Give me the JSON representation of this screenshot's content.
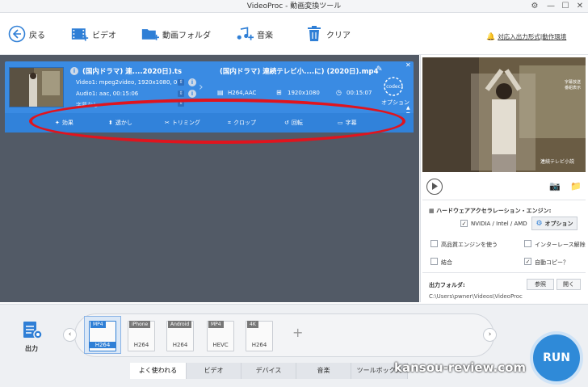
{
  "window": {
    "title": "VideoProc - 動画変換ツール",
    "controls": [
      "gear-icon",
      "minimize-icon",
      "maximize-icon",
      "close-icon"
    ]
  },
  "toolbar": {
    "back": "戻る",
    "video": "ビデオ",
    "video_folder": "動画フォルダ",
    "music": "音楽",
    "clear": "クリア",
    "notice": "対応入出力形式|動作環境"
  },
  "file": {
    "input_name": "(国内ドラマ) 連....2020日).ts",
    "video_info": "Video1: mpeg2video, 1920x1080, 0...",
    "audio_info": "Audio1: aac, 00:15:06",
    "subtitle_info": "字幕なし",
    "output_name": "(国内ドラマ) 連続テレビ小....に) (2020日).mp4",
    "output_codec": "H264,AAC",
    "output_resolution": "1920x1080",
    "output_duration": "00:15:07",
    "option_label": "オプション",
    "codec_label": "codec"
  },
  "edit": {
    "effect": "効果",
    "watermark": "透かし",
    "trim": "トリミング",
    "crop": "クロップ",
    "rotate": "回転",
    "subtitle": "字幕"
  },
  "preview": {
    "overlay_line1": "字幕放送",
    "overlay_line2": "番組表示",
    "overlay_line3": "連続テレビ小説"
  },
  "settings": {
    "hw_title": "ハードウェアアクセラレーション・エンジン:",
    "hw_engine": "NVIDIA / Intel / AMD",
    "hw_engine_checked": true,
    "option_button": "オプション",
    "high_quality": "高品質エンジンを使う",
    "high_quality_checked": false,
    "deinterlace": "インターレース解除",
    "deinterlace_checked": false,
    "merge": "結合",
    "merge_checked": false,
    "auto_copy": "自動コピー？",
    "auto_copy_checked": true,
    "output_folder_label": "出力フォルダ:",
    "browse": "参照",
    "open": "開く",
    "output_path": "C:\\Users\\pwner\\Videos\\VideoProc"
  },
  "output": {
    "label": "出力",
    "formats": [
      {
        "tag": "MP4",
        "codec": "H264",
        "selected": true
      },
      {
        "tag": "iPhone",
        "codec": "H264",
        "selected": false
      },
      {
        "tag": "Android",
        "codec": "H264",
        "selected": false
      },
      {
        "tag": "MP4",
        "codec": "HEVC",
        "selected": false
      },
      {
        "tag": "4K",
        "codec": "H264",
        "selected": false
      }
    ],
    "tabs": [
      "よく使われる",
      "ビデオ",
      "デバイス",
      "音楽",
      "ツールボックス"
    ],
    "run": "RUN"
  },
  "watermark_text": "kansou-review.com",
  "colors": {
    "accent": "#3a8be3",
    "panel_dark": "#525a66",
    "highlight_oval": "#e0141e",
    "run_button": "#2f8ad8"
  }
}
